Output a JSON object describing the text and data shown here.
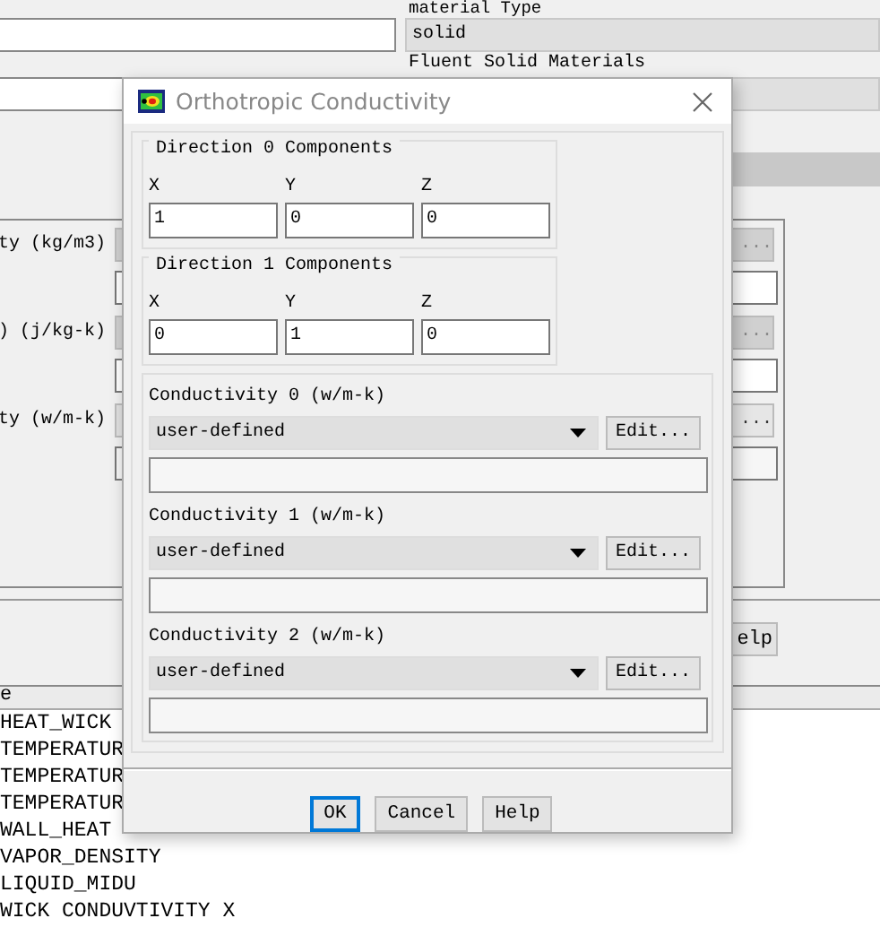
{
  "background": {
    "material_type_label": "material Type",
    "material_type": "solid",
    "materials_label": "Fluent Solid Materials",
    "properties": [
      {
        "label": "ty (kg/m3)",
        "button": "...",
        "disabled": true
      },
      {
        "label": ") (j/kg-k)",
        "button": "...",
        "disabled": true
      },
      {
        "label": "ty (w/m-k)",
        "button": "...",
        "disabled": false
      }
    ],
    "help_button": "elp",
    "list": {
      "header": "e",
      "items": [
        "HEAT_WICK",
        "TEMPERATUR",
        "TEMPERATUR",
        "TEMPERATUR",
        "WALL_HEAT",
        "VAPOR_DENSITY",
        "LIQUID_MIDU",
        "WICK CONDUVTIVITY X"
      ]
    }
  },
  "dialog": {
    "title": "Orthotropic Conductivity",
    "directions": [
      {
        "title": "Direction 0 Components",
        "fields": [
          {
            "label": "X",
            "value": "1"
          },
          {
            "label": "Y",
            "value": "0"
          },
          {
            "label": "Z",
            "value": "0"
          }
        ]
      },
      {
        "title": "Direction 1 Components",
        "fields": [
          {
            "label": "X",
            "value": "0"
          },
          {
            "label": "Y",
            "value": "1"
          },
          {
            "label": "Z",
            "value": "0"
          }
        ]
      }
    ],
    "conductivities": [
      {
        "label": "Conductivity 0 (w/m-k)",
        "method": "user-defined",
        "edit_button": "Edit..."
      },
      {
        "label": "Conductivity 1 (w/m-k)",
        "method": "user-defined",
        "edit_button": "Edit..."
      },
      {
        "label": "Conductivity 2 (w/m-k)",
        "method": "user-defined",
        "edit_button": "Edit..."
      }
    ],
    "buttons": [
      {
        "label": "OK",
        "focused": true
      },
      {
        "label": "Cancel",
        "focused": false
      },
      {
        "label": "Help",
        "focused": false
      }
    ]
  }
}
